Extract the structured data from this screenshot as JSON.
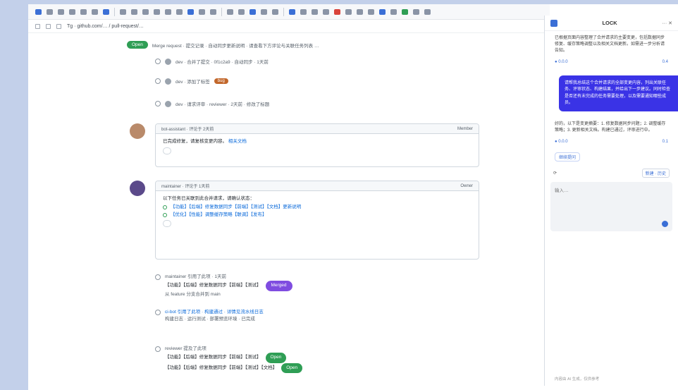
{
  "address_bar": {
    "url": "Tg · github.com/… / pull-request/…"
  },
  "feed": {
    "banner": {
      "badge": "Open",
      "text": "Merge request · 提交记录 · 自动同步更新说明 · 请查看下方评论与关联任务列表 …"
    },
    "events": [
      {
        "text": "dev · 合并了提交 · 0f1c2a9 · 自动同步 · 1天前"
      },
      {
        "text": "dev · 添加了标签",
        "label": "bug"
      },
      {
        "text": "dev · 请求评审 · reviewer · 2天前 · 修改了标题"
      }
    ],
    "comment1": {
      "author": "bot-assistant · 评论于 2天前",
      "role": "Member",
      "body": "已完成修复，请复核变更内容。",
      "link": "相关文档"
    },
    "comment2": {
      "author": "maintainer · 评论于 1天前",
      "role": "Owner",
      "body": "以下任务已关联到此合并请求，请确认状态：",
      "tasks": [
        "【功能】【后端】修复数据同步【前端】【测试】【文档】更新说明",
        "【优化】【性能】调整缓存策略【联调】【发布】"
      ]
    },
    "refs": [
      {
        "meta": "maintainer 引用了此项 · 1天前",
        "title": "【功能】【后端】修复数据同步【前端】【测试】",
        "status": "Merged",
        "sub": "从 feature 分支合并到 main"
      },
      {
        "meta": "ci-bot 引用了此项 · 构建通过 · 详情见流水线日志",
        "sub": "构建日志 · 运行测试 · 部署预览环境 · 已完成"
      },
      {
        "meta": "reviewer 提及了此项",
        "title": "【功能】【后端】修复数据同步【前端】【测试】",
        "status": "Open",
        "sub": "【功能】【后端】修复数据同步【前端】【测试】【文档】",
        "status2": "Open"
      }
    ]
  },
  "chat": {
    "title": "LOCK",
    "controls": "··· ✕",
    "msg1": "已根据页面内容整理了合并请求的主要变更，包括数据同步修复、缓存策略调整以及相关文档更新。如需进一步分析请告知。",
    "msg1_meta_left": "● 0.0.0",
    "msg1_meta_right": "0.4",
    "user_msg": "请帮我总结这个合并请求的全部变更内容，列出关联任务、评审状态、构建结果，并给出下一步建议。同时检查是否还有未完成的任务需要处理，以及需要通知哪些成员。",
    "msg2": "好的，以下是变更摘要：1. 修复数据同步问题；2. 调整缓存策略；3. 更新相关文档。构建已通过，评审进行中。",
    "msg2_meta_left": "● 0.0.0",
    "msg2_meta_right": "0.1",
    "chip": "继续提问",
    "tool_left": "⟳",
    "tool_right": "新建 · 历史",
    "input_placeholder": "输入…",
    "footer": "内容由 AI 生成，仅供参考"
  }
}
